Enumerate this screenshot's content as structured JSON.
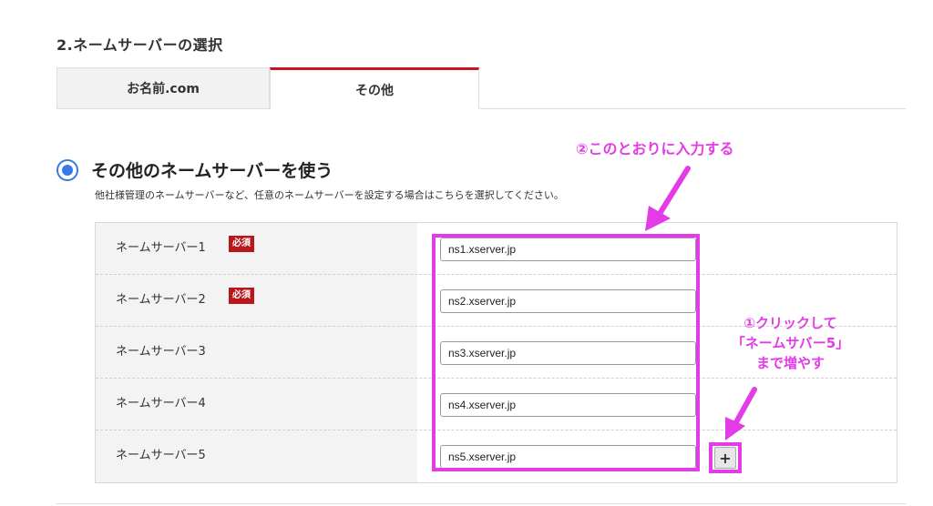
{
  "section_title": "2.ネームサーバーの選択",
  "tabs": [
    {
      "label": "お名前.com",
      "active": false
    },
    {
      "label": "その他",
      "active": true
    }
  ],
  "option": {
    "label": "その他のネームサーバーを使う",
    "description": "他社様管理のネームサーバーなど、任意のネームサーバーを設定する場合はこちらを選択してください。",
    "selected": true
  },
  "nameservers": [
    {
      "label": "ネームサーバー1",
      "required": true,
      "value": "ns1.xserver.jp"
    },
    {
      "label": "ネームサーバー2",
      "required": true,
      "value": "ns2.xserver.jp"
    },
    {
      "label": "ネームサーバー3",
      "required": false,
      "value": "ns3.xserver.jp"
    },
    {
      "label": "ネームサーバー4",
      "required": false,
      "value": "ns4.xserver.jp"
    },
    {
      "label": "ネームサーバー5",
      "required": false,
      "value": "ns5.xserver.jp"
    }
  ],
  "required_badge": "必須",
  "add_button": "+",
  "annotations": {
    "step2": "②このとおりに入力する",
    "step1_lines": [
      "①クリックして",
      "「ネームサバー5」",
      "まで増やす"
    ]
  },
  "colors": {
    "accent_red": "#c4171c",
    "radio_blue": "#3b78e7",
    "annotation_magenta": "#e33ce6"
  }
}
